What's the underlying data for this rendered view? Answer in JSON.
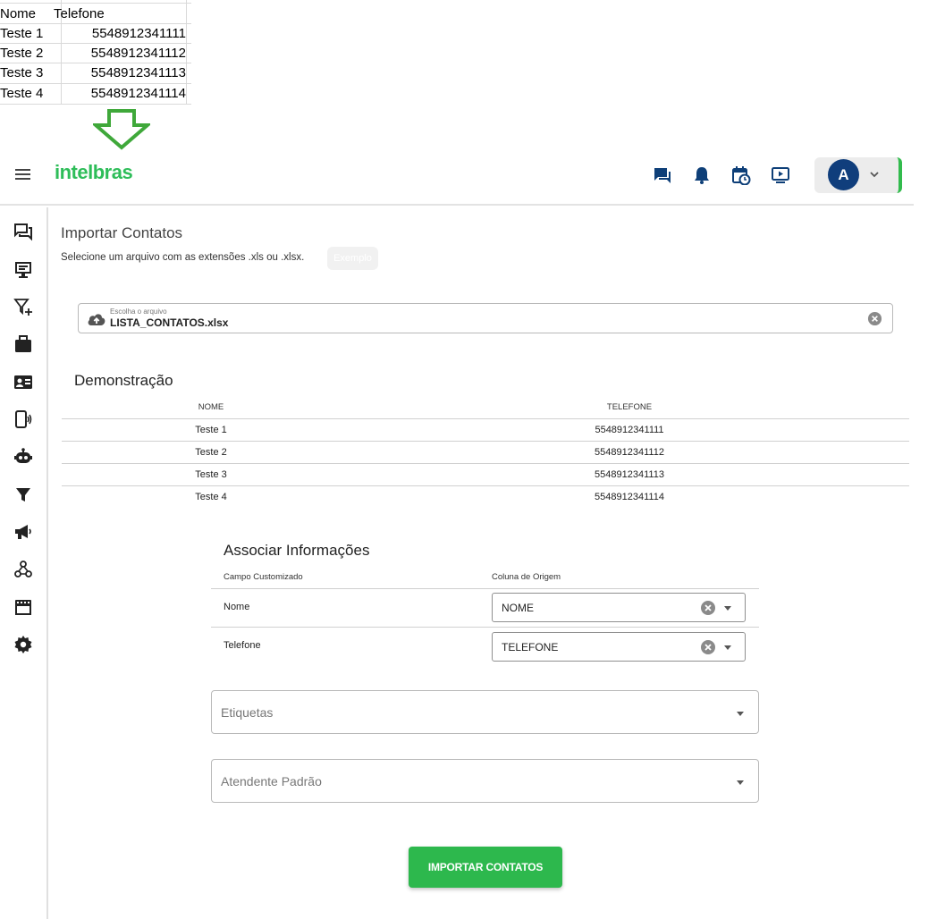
{
  "spreadsheet": {
    "headers": [
      "Nome",
      "Telefone"
    ],
    "rows": [
      [
        "Teste 1",
        "5548912341111"
      ],
      [
        "Teste 2",
        "5548912341112"
      ],
      [
        "Teste 3",
        "5548912341113"
      ],
      [
        "Teste 4",
        "5548912341114"
      ]
    ]
  },
  "arrow_icon": "down-arrow-icon",
  "header": {
    "logo_text": "intelbras",
    "icons": [
      "chat-icon",
      "bell-icon",
      "calendar-clock-icon",
      "video-play-icon"
    ],
    "avatar_letter": "A",
    "brand_color": "#2ebd59",
    "avatar_color": "#103e7c"
  },
  "sidebar": {
    "icons": [
      "chats-icon",
      "monitor-icon",
      "filter-plus-icon",
      "briefcase-icon",
      "contact-card-icon",
      "phone-signal-icon",
      "robot-icon",
      "filter-icon",
      "megaphone-icon",
      "webhook-icon",
      "store-icon",
      "settings-icon"
    ]
  },
  "main": {
    "title": "Importar Contatos",
    "subtitle": "Selecione um arquivo com as extensões .xls ou .xlsx.",
    "example_button": "Exemplo",
    "file_field": {
      "label": "Escolha o arquivo",
      "value": "LISTA_CONTATOS.xlsx"
    },
    "demo": {
      "title": "Demonstração",
      "headers": [
        "NOME",
        "TELEFONE"
      ],
      "rows": [
        [
          "Teste 1",
          "5548912341111"
        ],
        [
          "Teste 2",
          "5548912341112"
        ],
        [
          "Teste 3",
          "5548912341113"
        ],
        [
          "Teste 4",
          "5548912341114"
        ]
      ]
    },
    "associate": {
      "title": "Associar Informações",
      "header_field": "Campo Customizado",
      "header_source": "Coluna de Origem",
      "rows": [
        {
          "field": "Nome",
          "source": "NOME"
        },
        {
          "field": "Telefone",
          "source": "TELEFONE"
        }
      ]
    },
    "tags_label": "Etiquetas",
    "default_agent_label": "Atendente Padrão",
    "import_button": "IMPORTAR CONTATOS",
    "button_color": "#2db84d"
  }
}
